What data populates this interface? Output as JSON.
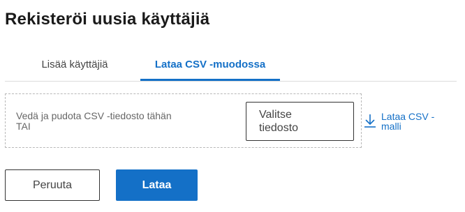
{
  "page": {
    "title": "Rekisteröi uusia käyttäjiä"
  },
  "tabs": [
    {
      "label": "Lisää käyttäjiä",
      "active": false
    },
    {
      "label": "Lataa CSV -muodossa",
      "active": true
    }
  ],
  "dropzone": {
    "line1": "Vedä ja pudota CSV -tiedosto tähän",
    "line2": "TAI",
    "choose_line1": "Valitse",
    "choose_line2": "tiedosto"
  },
  "template_link": {
    "line1": "Lataa CSV -",
    "line2": "malli",
    "icon": "download-icon"
  },
  "actions": {
    "cancel_label": "Peruuta",
    "upload_label": "Lataa"
  },
  "colors": {
    "accent": "#1470c7",
    "text": "#1a1a1a",
    "border": "#333333"
  }
}
